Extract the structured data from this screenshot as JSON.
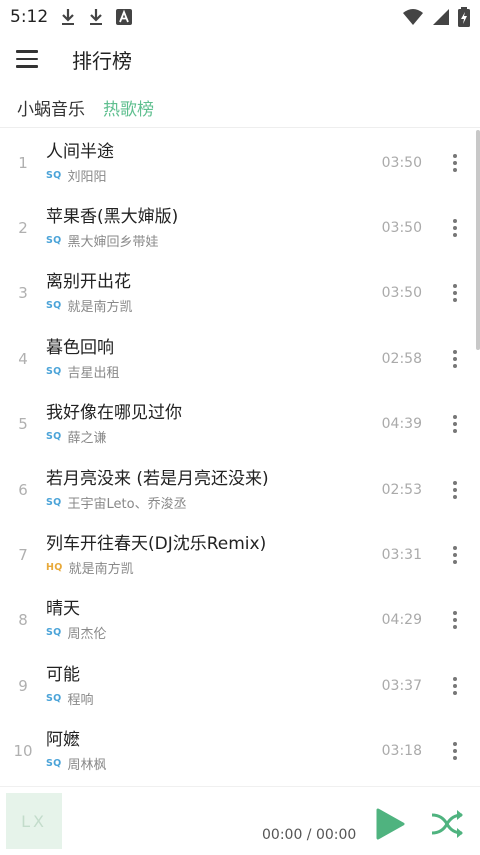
{
  "status": {
    "time": "5:12"
  },
  "header": {
    "title": "排行榜"
  },
  "tabs": [
    {
      "label": "小蜗音乐"
    },
    {
      "label": "热歌榜"
    }
  ],
  "songs": [
    {
      "no": "1",
      "title": "人间半途",
      "quality": "SQ",
      "artist": "刘阳阳",
      "duration": "03:50"
    },
    {
      "no": "2",
      "title": "苹果香(黑大婶版)",
      "quality": "SQ",
      "artist": "黑大婶回乡带娃",
      "duration": "03:50"
    },
    {
      "no": "3",
      "title": "离别开出花",
      "quality": "SQ",
      "artist": "就是南方凯",
      "duration": "03:50"
    },
    {
      "no": "4",
      "title": "暮色回响",
      "quality": "SQ",
      "artist": "吉星出租",
      "duration": "02:58"
    },
    {
      "no": "5",
      "title": "我好像在哪见过你",
      "quality": "SQ",
      "artist": "薛之谦",
      "duration": "04:39"
    },
    {
      "no": "6",
      "title": "若月亮没来 (若是月亮还没来)",
      "quality": "SQ",
      "artist": "王宇宙Leto、乔浚丞",
      "duration": "02:53"
    },
    {
      "no": "7",
      "title": "列车开往春天(DJ沈乐Remix)",
      "quality": "HQ",
      "artist": "就是南方凯",
      "duration": "03:31"
    },
    {
      "no": "8",
      "title": "晴天",
      "quality": "SQ",
      "artist": "周杰伦",
      "duration": "04:29"
    },
    {
      "no": "9",
      "title": "可能",
      "quality": "SQ",
      "artist": "程响",
      "duration": "03:37"
    },
    {
      "no": "10",
      "title": "阿嬷",
      "quality": "SQ",
      "artist": "周林枫",
      "duration": "03:18"
    }
  ],
  "player": {
    "cover_text": "LX",
    "time": "00:00 / 00:00"
  },
  "colors": {
    "accent": "#5fbf8f",
    "sq": "#4aa3d8",
    "hq": "#e8a93a"
  },
  "icons": [
    "download-icon",
    "download-icon",
    "a-icon",
    "wifi-icon",
    "signal-icon",
    "battery-icon",
    "menu-icon",
    "more-vertical-icon",
    "play-icon",
    "next-icon"
  ]
}
